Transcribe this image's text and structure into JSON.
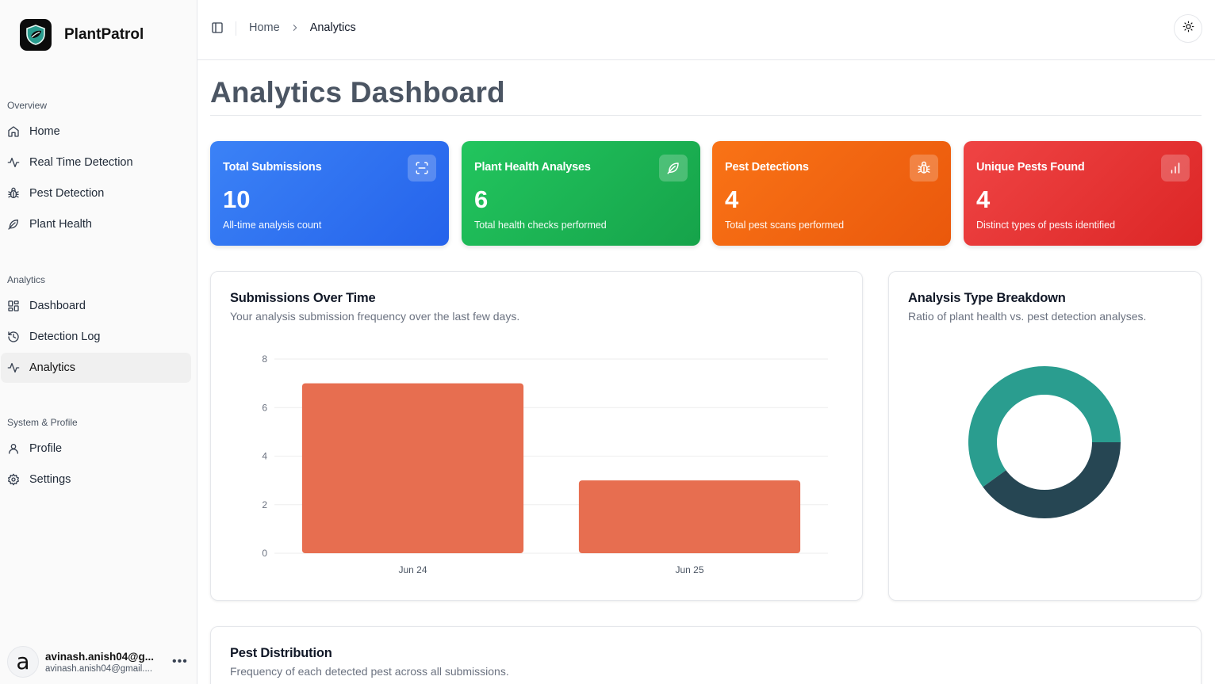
{
  "app": {
    "name": "PlantPatrol"
  },
  "sidebar": {
    "sections": [
      {
        "heading": "Overview",
        "items": [
          {
            "label": "Home",
            "icon": "home-icon"
          },
          {
            "label": "Real Time Detection",
            "icon": "activity-icon"
          },
          {
            "label": "Pest Detection",
            "icon": "bug-icon"
          },
          {
            "label": "Plant Health",
            "icon": "leaf-icon"
          }
        ]
      },
      {
        "heading": "Analytics",
        "items": [
          {
            "label": "Dashboard",
            "icon": "grid-icon"
          },
          {
            "label": "Detection Log",
            "icon": "history-icon"
          },
          {
            "label": "Analytics",
            "icon": "activity-icon",
            "active": true
          }
        ]
      },
      {
        "heading": "System & Profile",
        "items": [
          {
            "label": "Profile",
            "icon": "user-icon"
          },
          {
            "label": "Settings",
            "icon": "gear-icon"
          }
        ]
      }
    ],
    "user": {
      "avatar_letter": "a",
      "name": "avinash.anish04@g...",
      "email": "avinash.anish04@gmail...."
    }
  },
  "header": {
    "breadcrumb": {
      "home": "Home",
      "current": "Analytics"
    }
  },
  "page": {
    "title": "Analytics Dashboard"
  },
  "stats": [
    {
      "title": "Total Submissions",
      "value": "10",
      "subtitle": "All-time analysis count",
      "icon": "scan-icon",
      "color_from": "#3b82f6",
      "color_to": "#2563eb"
    },
    {
      "title": "Plant Health Analyses",
      "value": "6",
      "subtitle": "Total health checks performed",
      "icon": "leaf-icon",
      "color_from": "#22c55e",
      "color_to": "#16a34a"
    },
    {
      "title": "Pest Detections",
      "value": "4",
      "subtitle": "Total pest scans performed",
      "icon": "bug-icon",
      "color_from": "#f97316",
      "color_to": "#ea580c"
    },
    {
      "title": "Unique Pests Found",
      "value": "4",
      "subtitle": "Distinct types of pests identified",
      "icon": "bar-chart-icon",
      "color_from": "#ef4444",
      "color_to": "#dc2626"
    }
  ],
  "submissions_card": {
    "title": "Submissions Over Time",
    "subtitle": "Your analysis submission frequency over the last few days."
  },
  "breakdown_card": {
    "title": "Analysis Type Breakdown",
    "subtitle": "Ratio of plant health vs. pest detection analyses."
  },
  "distribution_card": {
    "title": "Pest Distribution",
    "subtitle": "Frequency of each detected pest across all submissions."
  },
  "chart_data": [
    {
      "type": "bar",
      "categories": [
        "Jun 24",
        "Jun 25"
      ],
      "values": [
        7,
        3
      ],
      "yticks": [
        0,
        2,
        4,
        6,
        8
      ],
      "ylim": [
        0,
        8
      ],
      "grid": true,
      "color": "#e76e50"
    },
    {
      "type": "pie",
      "donut": true,
      "slices": [
        {
          "value": 6,
          "color": "#2a9d8f"
        },
        {
          "value": 4,
          "color": "#264653"
        }
      ]
    }
  ]
}
